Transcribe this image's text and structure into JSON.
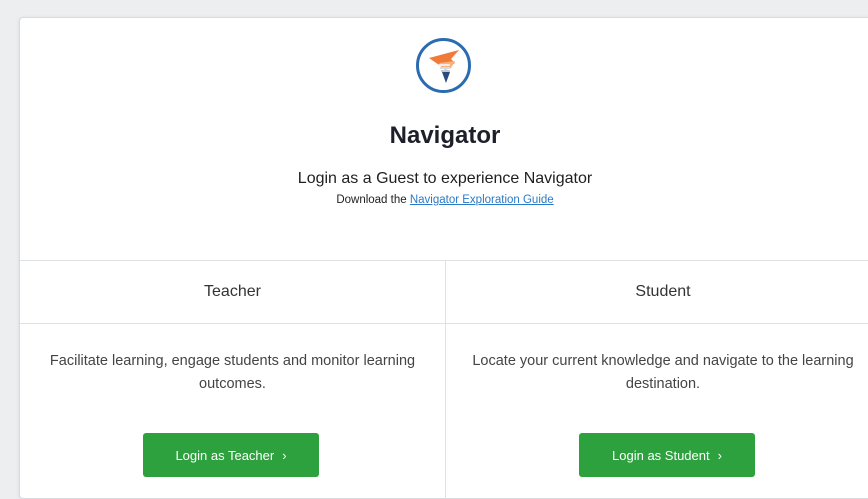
{
  "app": {
    "title": "Navigator",
    "subtitle": "Login as a Guest to experience Navigator",
    "download_prefix": "Download the ",
    "download_link": "Navigator Exploration Guide"
  },
  "teacher": {
    "heading": "Teacher",
    "description": "Facilitate learning, engage students and monitor learning outcomes.",
    "button_label": "Login as Teacher",
    "button_chevron": "›"
  },
  "student": {
    "heading": "Student",
    "description": "Locate your current knowledge and navigate to the learning destination.",
    "button_label": "Login as Student",
    "button_chevron": "›"
  },
  "colors": {
    "button_green": "#2ea13f",
    "link_blue": "#2a7ac7",
    "logo_ring": "#2b6cb0",
    "logo_orange": "#f07a3a"
  },
  "icons": {
    "logo": "navigator-compass-logo",
    "chevron": "chevron-right-icon"
  }
}
